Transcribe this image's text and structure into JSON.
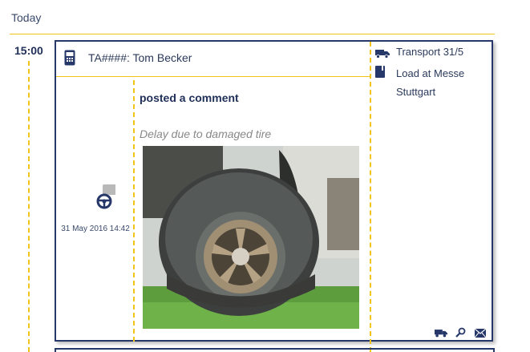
{
  "timeline": {
    "day_label": "Today",
    "time": "15:00"
  },
  "event": {
    "title": "TA####: Tom Becker",
    "action": "posted a comment",
    "comment": "Delay due to damaged tire",
    "date": "31 May 2016 14:42",
    "transport_label": "Transport 31/5",
    "load_label_line1": "Load at Messe",
    "load_label_line2": "Stuttgart",
    "photo_subject": "flat truck tire on grass"
  },
  "icons": {
    "header": "mobile-phone-icon",
    "transport": "truck-icon",
    "load": "book-icon",
    "avatar": "steering-wheel-icon",
    "comment_badge": "speech-bubble-icon",
    "footer": [
      "truck-icon",
      "search-icon",
      "envelope-icon"
    ]
  },
  "colors": {
    "accent_line": "#f0c419",
    "navy": "#263769"
  }
}
